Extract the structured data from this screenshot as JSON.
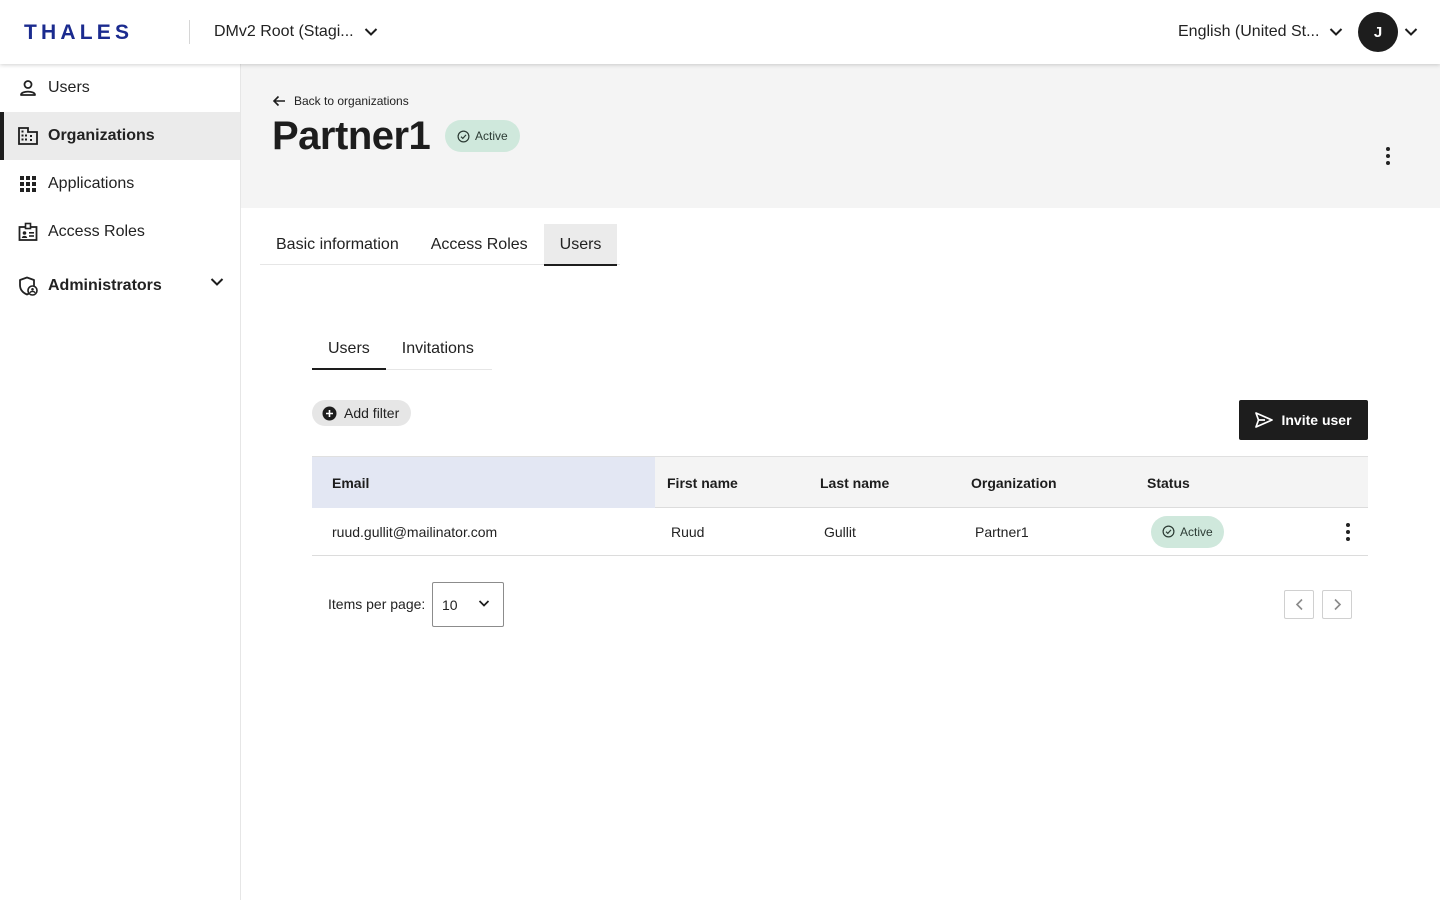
{
  "header": {
    "logo_text": "THALES",
    "org_switcher": "DMv2 Root (Stagi...",
    "language": "English (United St...",
    "avatar_initial": "J"
  },
  "sidebar": {
    "items": [
      {
        "label": "Users",
        "icon": "person-icon"
      },
      {
        "label": "Organizations",
        "icon": "building-icon",
        "active": true
      },
      {
        "label": "Applications",
        "icon": "apps-grid-icon"
      },
      {
        "label": "Access Roles",
        "icon": "badge-icon"
      },
      {
        "label": "Administrators",
        "icon": "shield-person-icon",
        "expandable": true
      }
    ]
  },
  "page": {
    "back_label": "Back to organizations",
    "title": "Partner1",
    "status": "Active"
  },
  "tabs": [
    {
      "label": "Basic information"
    },
    {
      "label": "Access Roles"
    },
    {
      "label": "Users",
      "selected": true
    }
  ],
  "subtabs": [
    {
      "label": "Users",
      "selected": true
    },
    {
      "label": "Invitations"
    }
  ],
  "toolbar": {
    "add_filter": "Add filter",
    "invite_user": "Invite user"
  },
  "table": {
    "columns": [
      "Email",
      "First name",
      "Last name",
      "Organization",
      "Status"
    ],
    "rows": [
      {
        "email": "ruud.gullit@mailinator.com",
        "first_name": "Ruud",
        "last_name": "Gullit",
        "organization": "Partner1",
        "status": "Active"
      }
    ]
  },
  "pagination": {
    "items_per_page_label": "Items per page:",
    "items_per_page_value": "10"
  },
  "colors": {
    "brand": "#1d1d1d",
    "logo_blue": "#1b2b8f",
    "active_badge_bg": "#cfe8dc",
    "selected_column_bg": "#e3e7f3"
  }
}
